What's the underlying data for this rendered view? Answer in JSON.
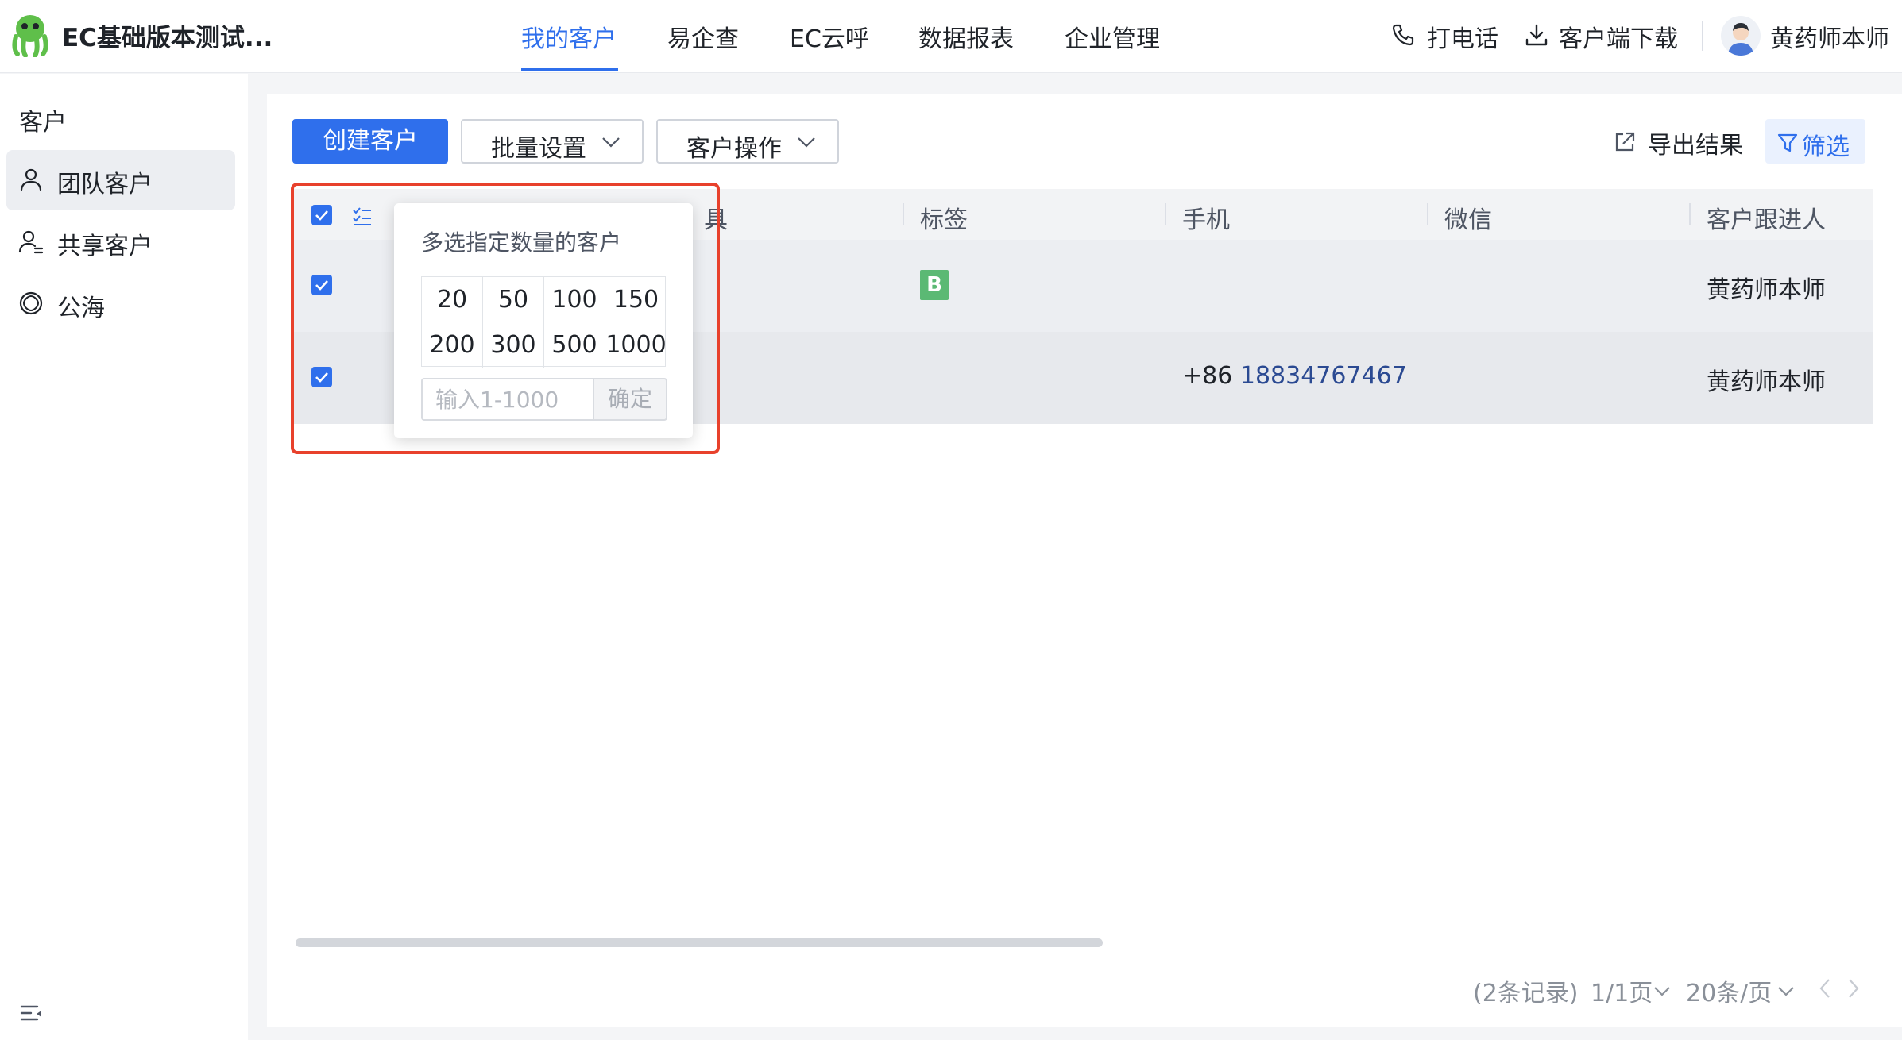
{
  "app": {
    "title": "EC基础版本测试..."
  },
  "nav": {
    "items": [
      {
        "label": "我的客户",
        "active": true
      },
      {
        "label": "易企查"
      },
      {
        "label": "EC云呼"
      },
      {
        "label": "数据报表"
      },
      {
        "label": "企业管理"
      }
    ]
  },
  "header_right": {
    "call": "打电话",
    "download": "客户端下载",
    "user": "黄药师本师"
  },
  "sidebar": {
    "heading": "客户",
    "items": [
      {
        "label": "团队客户",
        "icon": "person-icon",
        "active": true
      },
      {
        "label": "共享客户",
        "icon": "shared-person-icon"
      },
      {
        "label": "公海",
        "icon": "sea-icon"
      }
    ]
  },
  "toolbar": {
    "create": "创建客户",
    "batch": "批量设置",
    "ops": "客户操作",
    "export": "导出结果",
    "filter": "筛选"
  },
  "table": {
    "columns": [
      "具",
      "标签",
      "手机",
      "微信",
      "客户跟进人"
    ],
    "rows": [
      {
        "checked": true,
        "tag": "B",
        "phone_prefix": "",
        "phone": "",
        "wechat": "",
        "follower": "黄药师本师"
      },
      {
        "checked": true,
        "tag": "",
        "phone_prefix": "+86",
        "phone": "18834767467",
        "wechat": "",
        "follower": "黄药师本师"
      }
    ]
  },
  "popover": {
    "title": "多选指定数量的客户",
    "options": [
      "20",
      "50",
      "100",
      "150",
      "200",
      "300",
      "500",
      "1000"
    ],
    "placeholder": "输入1-1000",
    "confirm": "确定"
  },
  "pagination": {
    "records": "(2条记录)",
    "page": "1/1页",
    "per_page": "20条/页"
  },
  "colors": {
    "accent": "#2f6fec",
    "highlight": "#e8412c",
    "tag_b": "#5bb974"
  }
}
